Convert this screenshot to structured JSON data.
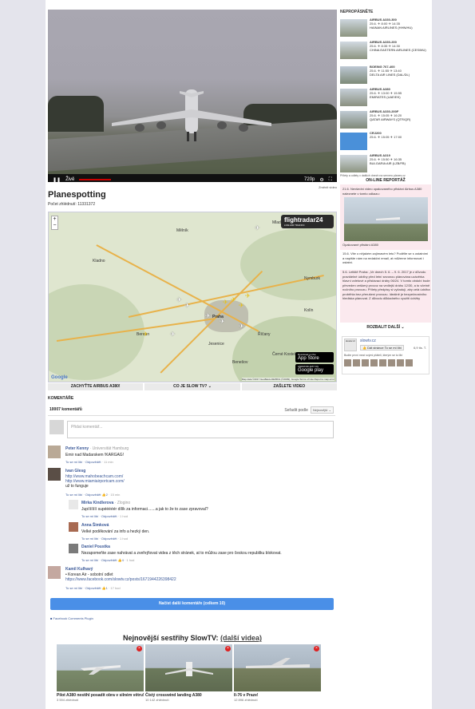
{
  "video": {
    "controls": {
      "live": "Živě",
      "quality": "720p",
      "note": "Změnit video"
    }
  },
  "main": {
    "title": "Planespotting",
    "views": "Počet zhlédnutí: 11331372"
  },
  "map": {
    "brand": "flightradar24",
    "brand_sub": "LIVE AIR TRAFFIC",
    "zoom_in": "+",
    "zoom_out": "−",
    "labels": [
      "Kladno",
      "Praha",
      "Beroun",
      "Benešov",
      "Kolín",
      "Mělník",
      "Mladá Boleslav",
      "Říčany",
      "Jesenice",
      "Černé Kostelec",
      "Nymburk"
    ],
    "app_store": {
      "small": "Download on the",
      "big": "App Store"
    },
    "google_play": {
      "small": "ANDROID APP ON",
      "big": "Google play"
    },
    "footer": "Map data ©2017 GeoBasis-DE/BKG (©2009), Google  Terms of Use  Report a map error",
    "google": "Google"
  },
  "tabs": [
    "ZACHYŤTE AIRBUS A380!",
    "CO JE SLOW TV? ⌄",
    "ZAŠLETE VIDEO"
  ],
  "comments": {
    "header": "KOMENTÁŘE",
    "count": "10007 komentářů",
    "sort_label": "Seřadit podle",
    "sort_value": "Nejnovější ⌄",
    "placeholder": "Přidat komentář...",
    "items": [
      {
        "name": "Peter Kenny",
        "sub": "· Universität Hamburg",
        "text": "Emir nad Madarskem !KARGAG!",
        "meta": "To se mi líbí · Odpovědět",
        "time": "· 11 min"
      },
      {
        "name": "Ivan Glesg",
        "sub": "",
        "text": "",
        "links": [
          "http://www.mahobeachcam.com/",
          "http://www.miamiairportcam.com/"
        ],
        "extra": "už to funguje",
        "meta": "To se mi líbí · Odpovědět",
        "likes": "2",
        "time": "· 15 min"
      },
      {
        "name": "Mirka Kindlerova",
        "sub": "· Zlogino",
        "text": "Jupíííííííí supééééér dílík za informaci.......a jak to že to zase zpravoval?",
        "meta": "To se mi líbí · Odpovědět",
        "time": "· 1 hod"
      },
      {
        "name": "Anna Šimková",
        "sub": "",
        "text": "Velké poděkování za info a hezký den.",
        "meta": "To se mi líbí · Odpovědět",
        "time": "· 1 hod"
      },
      {
        "name": "Daniel Poustka",
        "sub": "",
        "text": "Nezapomeňte zase nahrávat a zveřejňovat videa z těch stránek, at to můžou zase pro českou republiku blokovat.",
        "meta": "To se mi líbí · Odpovědět",
        "likes": "4",
        "time": "· 1 hod"
      },
      {
        "name": "Kamil Kulhavý",
        "sub": "",
        "text": "• Korean Air - sobotní odlet",
        "links": [
          "https://www.facebook.com/slowtv.cz/posts/1671944226398422"
        ],
        "meta": "To se mi líbí · Odpovědět",
        "likes": "1",
        "time": "· 17 hod"
      }
    ],
    "load_more": "Načíst další komentáře (celkem 10)",
    "plugin": "Facebook Comments Plugin"
  },
  "related": {
    "heading": "Nejnovější sestřihy SlowTV:",
    "heading_link": "(další videa)",
    "items": [
      {
        "caption": "Pilot A380 nestihl posadit obra v silném větru!",
        "views": "3 594 zhlédnutí"
      },
      {
        "caption": "Čistý crosswind landing A380",
        "views": "10 142 zhlédnutí"
      },
      {
        "caption": "Il-76 v Praze!",
        "views": "12 896 zhlédnutí"
      }
    ]
  },
  "sidebar": {
    "heading": "NEPROPÁSNĚTE",
    "flights": [
      {
        "type": "AIRBUS A330-300",
        "date": "25.6.",
        "dep": "8:00",
        "arr": "14:35",
        "airline": "HAINAN AIRLINES (HHN/HU)"
      },
      {
        "type": "AIRBUS A330-200",
        "date": "25.6.",
        "dep": "8:35",
        "arr": "14:30",
        "airline": "CHINA EASTERN AIRLINES (CES/MU)"
      },
      {
        "type": "BOEING 767-400",
        "date": "25.6.",
        "dep": "11:55",
        "arr": "13:40",
        "airline": "DELTA AIR LINES (DAL/DL)"
      },
      {
        "type": "AIRBUS A380",
        "date": "25.6.",
        "dep": "13:00",
        "arr": "15:55",
        "airline": "EMIRATES (UAE/EK)"
      },
      {
        "type": "AIRBUS A330-200F",
        "date": "25.6.",
        "dep": "15:05",
        "arr": "16:20",
        "airline": "QATAR AIRWAYS (QTR/QR)"
      },
      {
        "type": "CRJ200",
        "date": "25.6.",
        "dep": "15:05",
        "arr": "17:00",
        "airline": ""
      },
      {
        "type": "AIRBUS A319",
        "date": "25.6.",
        "dep": "15:50",
        "arr": "16:35",
        "airline": "BULGARIA AIR (LZB/FB)"
      }
    ],
    "flights_note": "Přílety a odlety v dalších dnech na serveru planes.cz",
    "online_heading": "ON-LINE REPORTÁŽ",
    "report1": "21.6. Nevšední video opakovaného přistání Airbus A380 naleznete v tomto odkazu:",
    "report1_caption": "Opakované přistání A380",
    "report2": "15.6. Vite o nějakém zajímavém letu? Podělte se s ostatními a napište nám na redakční email, at můžeme informovat i ostatní.",
    "report3": "5.6. Letiště Praha: „Ve dnech 5. 6. – 9. 6. 2017 je z důvodu pravidelné údržby před letní sezonou plánována uzávěrka hlavní vzletové a přistávací dráhy 06/24. V tomto období bude převeden veškerý provoz na vedlejší dráhu 12/30, a to včetně nočního provozu. Přílety předpisy si vyžadují, aby celá údržba proběhla bez přerušení provozu. Ideálně je bezpečnostního hlediska plánovat. Z důvodu důkladného využití údržby",
    "more": "ROZBALIT DALŠÍ ⌄",
    "fb": {
      "logo": "slowtv.cz",
      "title": "slowtv.cz",
      "like": "👍 Dát stránce To se mi líbí",
      "count": "6,9 tis. T.",
      "friends": "Budte první mezi svými přáteli, kterým se to líbí"
    }
  }
}
